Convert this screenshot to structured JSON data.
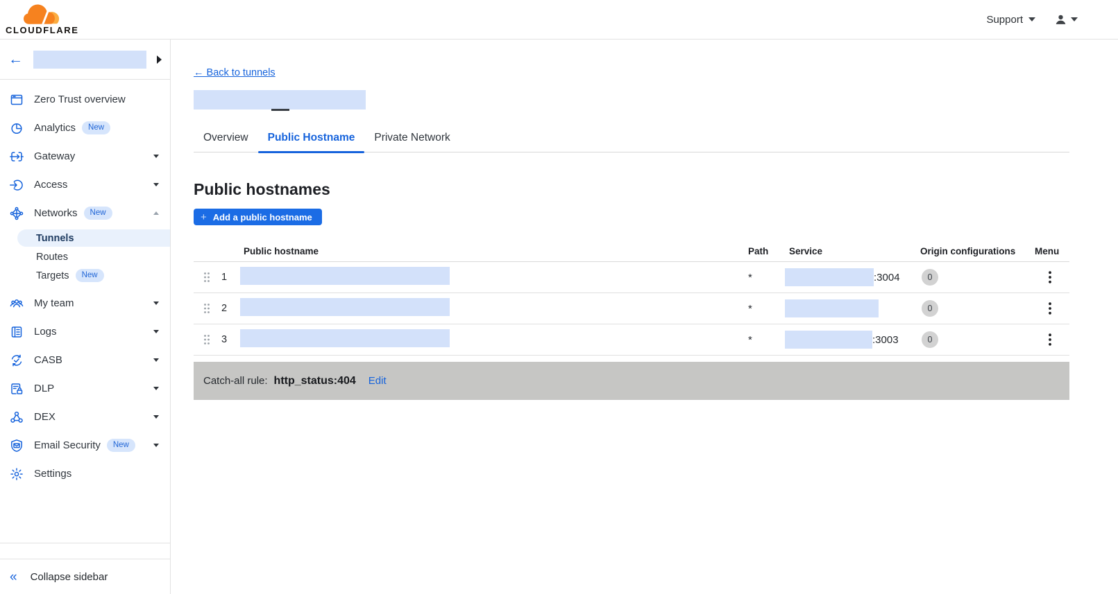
{
  "topbar": {
    "brand": "CLOUDFLARE",
    "support_label": "Support"
  },
  "glyphs": {
    "plus": "+",
    "back_arrow": "←",
    "collapse": "«"
  },
  "sidebar": {
    "account_name_redacted": true,
    "items": [
      {
        "label": "Zero Trust overview",
        "icon": "window-icon"
      },
      {
        "label": "Analytics",
        "icon": "pie-chart-icon",
        "badge": "New"
      },
      {
        "label": "Gateway",
        "icon": "gateway-icon",
        "caret": "down"
      },
      {
        "label": "Access",
        "icon": "access-icon",
        "caret": "down"
      },
      {
        "label": "Networks",
        "icon": "network-mesh-icon",
        "badge": "New",
        "caret": "up",
        "expanded": true,
        "children": [
          {
            "label": "Tunnels",
            "active": true
          },
          {
            "label": "Routes"
          },
          {
            "label": "Targets",
            "badge": "New"
          }
        ]
      },
      {
        "label": "My team",
        "icon": "team-icon",
        "caret": "down"
      },
      {
        "label": "Logs",
        "icon": "logs-icon",
        "caret": "down"
      },
      {
        "label": "CASB",
        "icon": "casb-sync-icon",
        "caret": "down"
      },
      {
        "label": "DLP",
        "icon": "dlp-lock-icon",
        "caret": "down"
      },
      {
        "label": "DEX",
        "icon": "dex-nodes-icon",
        "caret": "down"
      },
      {
        "label": "Email Security",
        "icon": "email-shield-icon",
        "badge": "New",
        "caret": "down"
      },
      {
        "label": "Settings",
        "icon": "gear-icon"
      }
    ],
    "collapse_label": "Collapse sidebar"
  },
  "main": {
    "back_link": "← Back to tunnels",
    "tunnel_name_redacted": true,
    "tabs": [
      {
        "label": "Overview",
        "active": false
      },
      {
        "label": "Public Hostname",
        "active": true
      },
      {
        "label": "Private Network",
        "active": false
      }
    ],
    "heading": "Public hostnames",
    "add_button_label": "Add a public hostname",
    "table": {
      "columns": [
        "Public hostname",
        "Path",
        "Service",
        "Origin configurations",
        "Menu"
      ],
      "rows": [
        {
          "index": "1",
          "hostname_redacted": true,
          "path": "*",
          "service_redacted": true,
          "service_port": ":3004",
          "origin_configurations": "0"
        },
        {
          "index": "2",
          "hostname_redacted": true,
          "path": "*",
          "service_redacted": true,
          "service_port": "",
          "origin_configurations": "0"
        },
        {
          "index": "3",
          "hostname_redacted": true,
          "path": "*",
          "service_redacted": true,
          "service_port": ":3003",
          "origin_configurations": "0"
        }
      ]
    },
    "catch_all": {
      "label": "Catch-all rule:",
      "value": "http_status:404",
      "edit_label": "Edit"
    }
  },
  "colors": {
    "accent_blue": "#1663dc",
    "button_blue": "#1b6ce5",
    "redaction_blue": "#d3e1fa",
    "active_item_bg": "#e9f1fc",
    "new_badge_bg": "#d6e5fc",
    "new_badge_text": "#2166d6",
    "catch_all_bg": "#c6c6c4",
    "count_badge_bg": "#d2d2d2",
    "brand_orange": "#f6821f",
    "brand_orange_light": "#fbad41"
  }
}
